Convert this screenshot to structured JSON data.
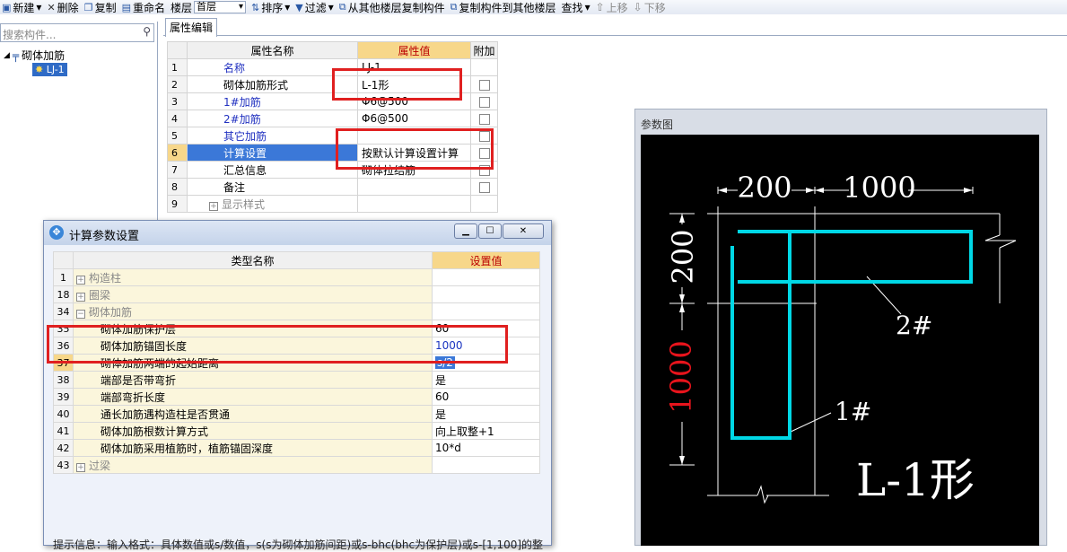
{
  "toolbar": {
    "new": "新建",
    "delete": "删除",
    "copy": "复制",
    "rename": "重命名",
    "floor_label": "楼层",
    "floor_value": "首层",
    "sort": "排序",
    "filter": "过滤",
    "copy_from": "从其他楼层复制构件",
    "copy_to": "复制构件到其他楼层",
    "find": "查找",
    "up": "上移",
    "down": "下移"
  },
  "search": {
    "placeholder": "搜索构件..."
  },
  "tree": {
    "root": "砌体加筋",
    "child": "LJ-1"
  },
  "tab": "属性编辑",
  "props": {
    "headers": [
      "属性名称",
      "属性值",
      "附加"
    ],
    "rows": [
      {
        "n": "1",
        "name": "名称",
        "value": "LJ-1"
      },
      {
        "n": "2",
        "name": "砌体加筋形式",
        "value": "L-1形"
      },
      {
        "n": "3",
        "name": "1#加筋",
        "value": "Φ6@500"
      },
      {
        "n": "4",
        "name": "2#加筋",
        "value": "Φ6@500"
      },
      {
        "n": "5",
        "name": "其它加筋",
        "value": ""
      },
      {
        "n": "6",
        "name": "计算设置",
        "value": "按默认计算设置计算"
      },
      {
        "n": "7",
        "name": "汇总信息",
        "value": "砌体拉结筋"
      },
      {
        "n": "8",
        "name": "备注",
        "value": ""
      },
      {
        "n": "9",
        "name": "显示样式",
        "value": ""
      }
    ]
  },
  "param": {
    "title": "参数图",
    "dim_top1": "200",
    "dim_top2": "1000",
    "dim_left1": "200",
    "dim_left2": "1000",
    "label_2": "2#",
    "label_1": "1#",
    "shape": "L-1形"
  },
  "dialog": {
    "title": "计算参数设置",
    "headers": [
      "类型名称",
      "设置值"
    ],
    "rows": [
      {
        "n": "1",
        "name": "构造柱",
        "value": ""
      },
      {
        "n": "18",
        "name": "圈梁",
        "value": ""
      },
      {
        "n": "34",
        "name": "砌体加筋",
        "value": ""
      },
      {
        "n": "35",
        "name": "砌体加筋保护层",
        "value": "60"
      },
      {
        "n": "36",
        "name": "砌体加筋锚固长度",
        "value": "1000"
      },
      {
        "n": "37",
        "name": "砌体加筋两端的起始距离",
        "value": "s/2"
      },
      {
        "n": "38",
        "name": "端部是否带弯折",
        "value": "是"
      },
      {
        "n": "39",
        "name": "端部弯折长度",
        "value": "60"
      },
      {
        "n": "40",
        "name": "通长加筋遇构造柱是否贯通",
        "value": "是"
      },
      {
        "n": "41",
        "name": "砌体加筋根数计算方式",
        "value": "向上取整+1"
      },
      {
        "n": "42",
        "name": "砌体加筋采用植筋时，植筋锚固深度",
        "value": "10*d"
      },
      {
        "n": "43",
        "name": "过梁",
        "value": ""
      }
    ],
    "tip": "提示信息：输入格式：具体数值或s/数值，s(s为砌体加筋间距)或s-bhc(bhc为保护层)或s-[1,100]的整"
  }
}
